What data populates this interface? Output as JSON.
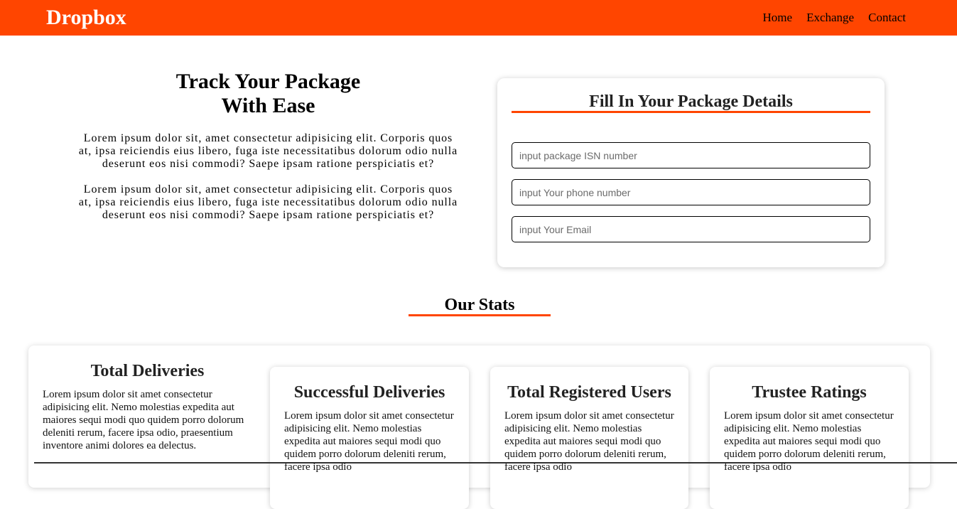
{
  "navbar": {
    "brand": "Dropbox",
    "links": [
      "Home",
      "Exchange",
      "Contact"
    ],
    "bg_color": "#ff4500"
  },
  "hero": {
    "title_line1": "Track Your Package",
    "title_line2": "With Ease",
    "paragraphs": [
      "Lorem ipsum dolor sit, amet consectetur adipisicing elit. Corporis quos at, ipsa reiciendis eius libero, fuga iste necessitatibus dolorum odio nulla deserunt eos nisi commodi? Saepe ipsam ratione perspiciatis et?",
      "Lorem ipsum dolor sit, amet consectetur adipisicing elit. Corporis quos at, ipsa reiciendis eius libero, fuga iste necessitatibus dolorum odio nulla deserunt eos nisi commodi? Saepe ipsam ratione perspiciatis et?"
    ]
  },
  "form": {
    "title": "Fill In Your Package Details",
    "inputs": [
      {
        "placeholder": "input package ISN number",
        "value": ""
      },
      {
        "placeholder": "input Your phone number",
        "value": ""
      },
      {
        "placeholder": "input Your Email",
        "value": ""
      }
    ],
    "accent_color": "#ff4500"
  },
  "stats": {
    "title": "Our Stats",
    "cards": [
      {
        "title": "Total Deliveries",
        "text": "Lorem ipsum dolor sit amet consectetur adipisicing elit. Nemo molestias expedita aut maiores sequi modi quo quidem porro dolorum deleniti rerum, facere ipsa odio, praesentium inventore animi dolores ea delectus."
      },
      {
        "title": "Successful Deliveries",
        "text": "Lorem ipsum dolor sit amet consectetur adipisicing elit. Nemo molestias expedita aut maiores sequi modi quo quidem porro dolorum deleniti rerum, facere ipsa odio"
      },
      {
        "title": "Total Registered Users",
        "text": "Lorem ipsum dolor sit amet consectetur adipisicing elit. Nemo molestias expedita aut maiores sequi modi quo quidem porro dolorum deleniti rerum, facere ipsa odio"
      },
      {
        "title": "Trustee Ratings",
        "text": "Lorem ipsum dolor sit amet consectetur adipisicing elit. Nemo molestias expedita aut maiores sequi modi quo quidem porro dolorum deleniti rerum, facere ipsa odio"
      }
    ]
  }
}
